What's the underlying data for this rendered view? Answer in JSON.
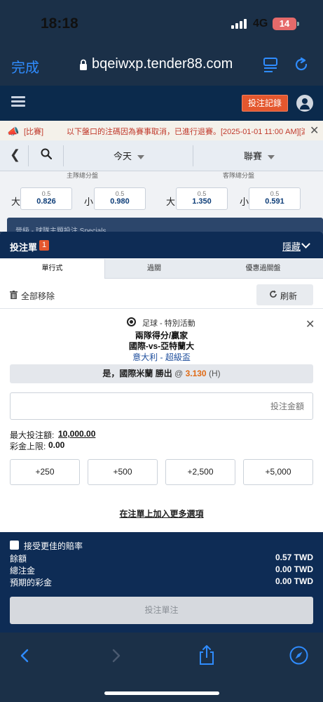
{
  "status": {
    "time": "18:18",
    "network": "4G",
    "battery": "14"
  },
  "safari": {
    "done_label": "完成",
    "url": "bqeiwxp.tender88.com"
  },
  "site_header": {
    "records_label": "投注記錄"
  },
  "announcement": {
    "tag": "[比賽]",
    "text": "以下盤口的注碼因為賽事取消，已進行退賽。[2025-01-01 11:00 AM][滬"
  },
  "filters": {
    "date": "今天",
    "league": "聯賽"
  },
  "odds_bg": {
    "header_left": "主隊總分盤",
    "header_right": "客隊總分盤",
    "over_label": "大",
    "under_label": "小",
    "cells": [
      {
        "line": "0.5",
        "odds": "0.826"
      },
      {
        "line": "0.5",
        "odds": "0.980"
      },
      {
        "line": "0.5",
        "odds": "1.350"
      },
      {
        "line": "0.5",
        "odds": "0.591"
      }
    ],
    "specials_label": "晉級 - 球隊主題投注 Specials"
  },
  "betslip": {
    "title": "投注單",
    "count": "1",
    "hide_label": "隱藏",
    "tabs": [
      "單行式",
      "過關",
      "優惠過關盤"
    ],
    "remove_all": "全部移除",
    "refresh": "刷新",
    "selection": {
      "sport": "足球 - 特別活動",
      "market": "兩隊得分/贏家",
      "match": "國際-vs-亞特蘭大",
      "league": "意大利 - 超級盃",
      "pick": "是，國際米蘭 勝出",
      "at": "@",
      "price": "3.130",
      "suffix": "(H)"
    },
    "stake_placeholder": "投注金額",
    "max_bet_label": "最大投注額:",
    "max_bet_value": "10,000.00",
    "max_win_label": "彩金上限:",
    "max_win_value": "0.00",
    "quick_amounts": [
      "+250",
      "+500",
      "+2,500",
      "+5,000"
    ],
    "more_options": "在注單上加入更多選項"
  },
  "summary": {
    "accept_better_odds": "接受更佳的賠率",
    "balance_label": "餘額",
    "balance_value": "0.57 TWD",
    "total_stake_label": "總注金",
    "total_stake_value": "0.00 TWD",
    "expected_win_label": "預期的彩金",
    "expected_win_value": "0.00 TWD",
    "place_bet": "投注單注"
  },
  "colors": {
    "navy": "#0e2c55",
    "accent": "#e4572e",
    "price": "#e06a14",
    "link": "#2f8cff"
  }
}
